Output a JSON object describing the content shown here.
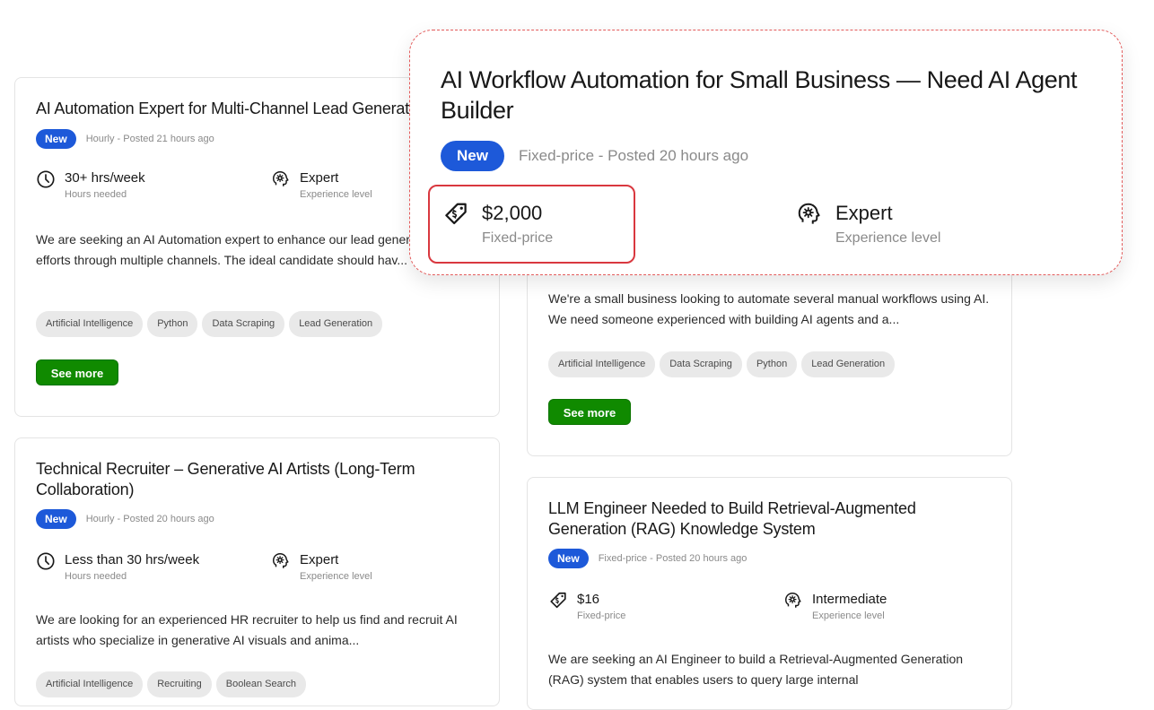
{
  "cards": [
    {
      "title": "AI Automation Expert for Multi-Channel Lead Generation",
      "badge": "New",
      "posted": "Hourly - Posted 21 hours ago",
      "stat1": {
        "icon": "clock-icon",
        "value": "30+ hrs/week",
        "label": "Hours needed"
      },
      "stat2": {
        "icon": "brain-gear-icon",
        "value": "Expert",
        "label": "Experience level"
      },
      "description": "We are seeking an AI Automation expert to enhance our lead generation efforts through multiple channels. The ideal candidate should hav...",
      "tags": [
        "Artificial Intelligence",
        "Python",
        "Data Scraping",
        "Lead Generation"
      ],
      "button": "See more"
    },
    {
      "title": "AI Workflow Automation for Small Business — Need AI Agent Builder",
      "description": "We're a small business looking to automate several manual workflows using AI. We need someone experienced with building AI agents and a...",
      "tags": [
        "Artificial Intelligence",
        "Data Scraping",
        "Python",
        "Lead Generation"
      ],
      "button": "See more"
    },
    {
      "title": "Technical Recruiter – Generative AI Artists (Long-Term Collaboration)",
      "badge": "New",
      "posted": "Hourly - Posted 20 hours ago",
      "stat1": {
        "icon": "clock-icon",
        "value": "Less than 30 hrs/week",
        "label": "Hours needed"
      },
      "stat2": {
        "icon": "brain-gear-icon",
        "value": "Expert",
        "label": "Experience level"
      },
      "description": "We are looking for an experienced HR recruiter to help us find and recruit AI artists who specialize in generative AI visuals and anima...",
      "tags": [
        "Artificial Intelligence",
        "Recruiting",
        "Boolean Search"
      ]
    },
    {
      "title": "LLM Engineer Needed to Build Retrieval-Augmented Generation (RAG) Knowledge System",
      "badge": "New",
      "posted": "Fixed-price - Posted 20 hours ago",
      "stat1": {
        "icon": "price-tag-icon",
        "value": "$16",
        "label": "Fixed-price"
      },
      "stat2": {
        "icon": "brain-gear-icon",
        "value": "Intermediate",
        "label": "Experience level"
      },
      "description": "We are seeking an AI Engineer to build a Retrieval-Augmented Generation (RAG) system that enables users to query large internal"
    }
  ],
  "zoom": {
    "title": "AI Workflow Automation for Small Business — Need AI Agent Builder",
    "badge": "New",
    "posted": "Fixed-price - Posted 20 hours ago",
    "stat1": {
      "icon": "price-tag-icon",
      "value": "$2,000",
      "label": "Fixed-price"
    },
    "stat2": {
      "icon": "brain-gear-icon",
      "value": "Expert",
      "label": "Experience level"
    },
    "highlight_color": "#d9383f"
  },
  "colors": {
    "badge": "#1d59d9",
    "button": "#108a00",
    "tag_bg": "#e9e9e9",
    "muted_text": "#8a8a8a"
  }
}
